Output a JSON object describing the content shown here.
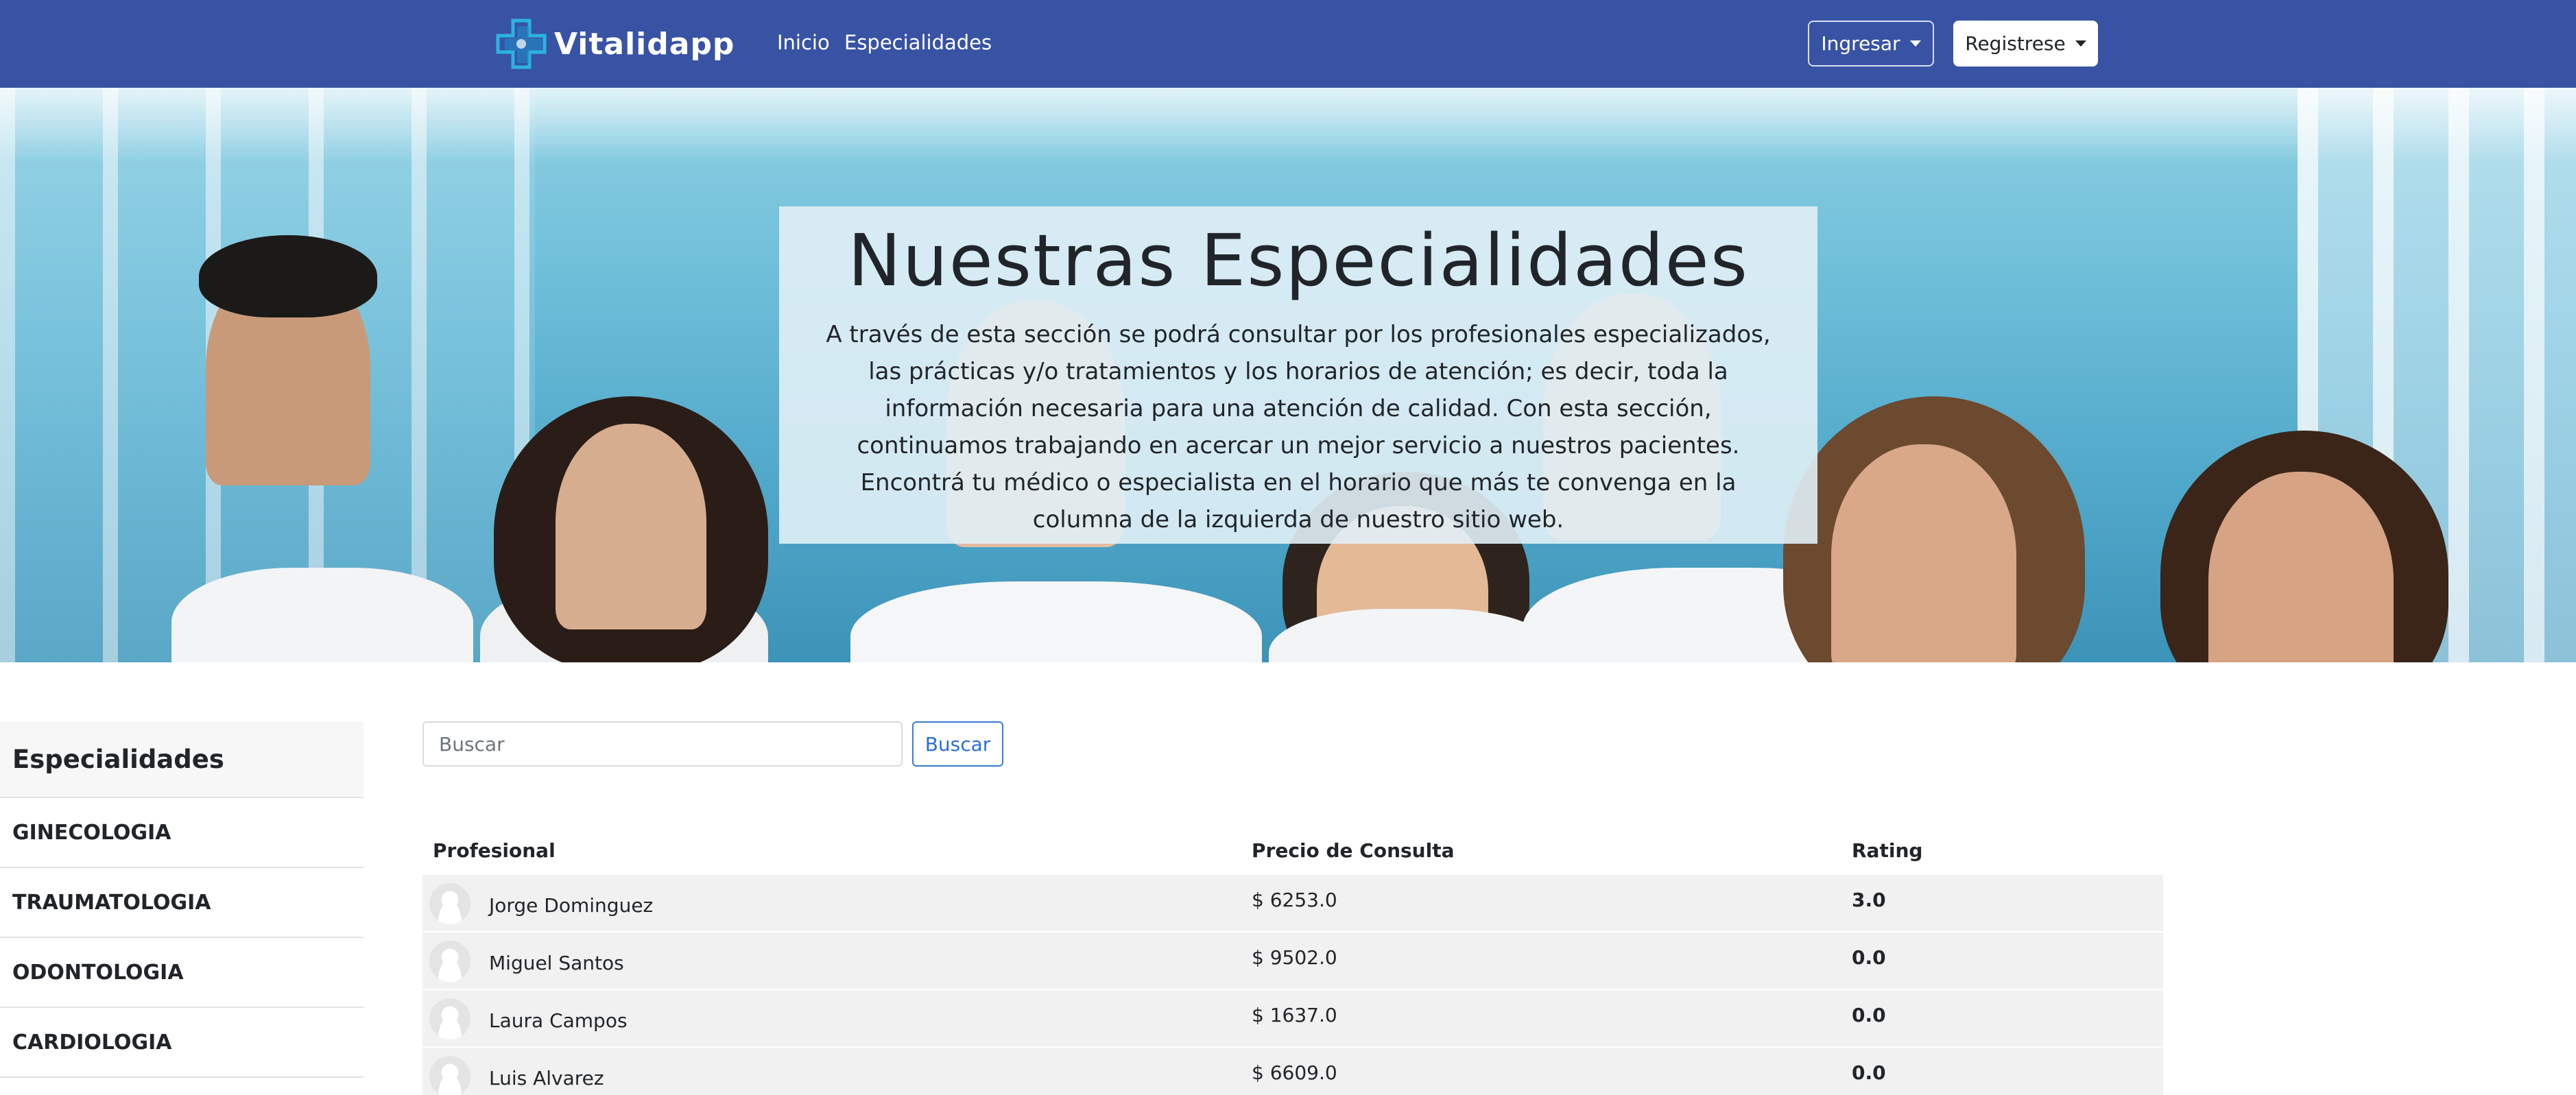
{
  "brand": {
    "name": "Vitalidapp",
    "logo_icon": "cross-logo-icon"
  },
  "nav": {
    "inicio": "Inicio",
    "especialidades": "Especialidades"
  },
  "auth": {
    "ingresar": "Ingresar",
    "registrese": "Registrese"
  },
  "hero": {
    "title": "Nuestras Especialidades",
    "text": "A través de esta sección se podrá consultar por los profesionales especializados, las prácticas y/o tratamientos y los horarios de atención; es decir, toda la información necesaria para una atención de calidad. Con esta sección, continuamos trabajando en acercar un mejor servicio a nuestros pacientes. Encontrá tu médico o especialista en el horario que más te convenga en la columna de la izquierda de nuestro sitio web."
  },
  "sidebar": {
    "title": "Especialidades",
    "items": [
      {
        "label": "GINECOLOGIA"
      },
      {
        "label": "TRAUMATOLOGIA"
      },
      {
        "label": "ODONTOLOGIA"
      },
      {
        "label": "CARDIOLOGIA"
      }
    ]
  },
  "search": {
    "placeholder": "Buscar",
    "value": "",
    "button": "Buscar"
  },
  "table": {
    "headers": {
      "profesional": "Profesional",
      "precio": "Precio de Consulta",
      "rating": "Rating"
    },
    "rows": [
      {
        "name": "Jorge Dominguez",
        "precio": "$ 6253.0",
        "rating": "3.0"
      },
      {
        "name": "Miguel Santos",
        "precio": "$ 9502.0",
        "rating": "0.0"
      },
      {
        "name": "Laura Campos",
        "precio": "$ 1637.0",
        "rating": "0.0"
      },
      {
        "name": "Luis Alvarez",
        "precio": "$ 6609.0",
        "rating": "0.0"
      }
    ]
  },
  "colors": {
    "navbar": "#3853a4",
    "accent": "#2a6ed0",
    "logo_primary": "#2bb3e0"
  }
}
